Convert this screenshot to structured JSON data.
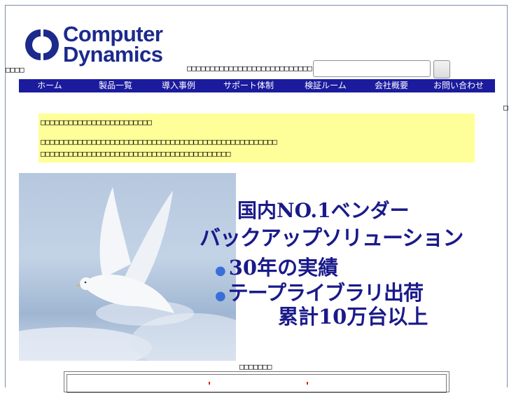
{
  "logo": {
    "line1": "Computer",
    "line2": "Dynamics",
    "brand_color": "#1c2a8c"
  },
  "header": {
    "top_left_text": "□□□□",
    "search_caption": "□□□□□□□□□□□□□□□□□□□□□□□□□□□ □□",
    "search_value": "",
    "search_icon": "search-button-blank"
  },
  "nav": {
    "background": "#1b1b9e",
    "items": [
      {
        "label": "ホーム"
      },
      {
        "label": "製品一覧"
      },
      {
        "label": "導入事例"
      },
      {
        "label": "サポート体制"
      },
      {
        "label": "検証ルーム"
      },
      {
        "label": "会社概要"
      },
      {
        "label": "お問い合わせ"
      }
    ]
  },
  "right_edge_glyph": "□",
  "notice": {
    "background": "#ffff99",
    "line1": "□□□□□□□□□□□□□□□□□□□□□□□□",
    "line2": "□□□□□□□□□□□□□□□□□□□□□□□□□□□□□□□□□□□□□□□□□□□□□□□□□□□",
    "line3": "□□□□□□□□□□□□□□□□□□□□□□□□□□□□□□□□□□□□□□□□□"
  },
  "banner": {
    "line1": "国内NO.1ベンダー",
    "line2": "バックアップソリューション",
    "line3": "30年の実績",
    "line4": "テープライブラリ出荷",
    "line5": "累計10万台以上",
    "text_color": "#1a1a8a",
    "bullet_color": "#3a6fd8"
  },
  "bottom": {
    "caption": "□□□□□□□",
    "accent": "#e0201a"
  }
}
